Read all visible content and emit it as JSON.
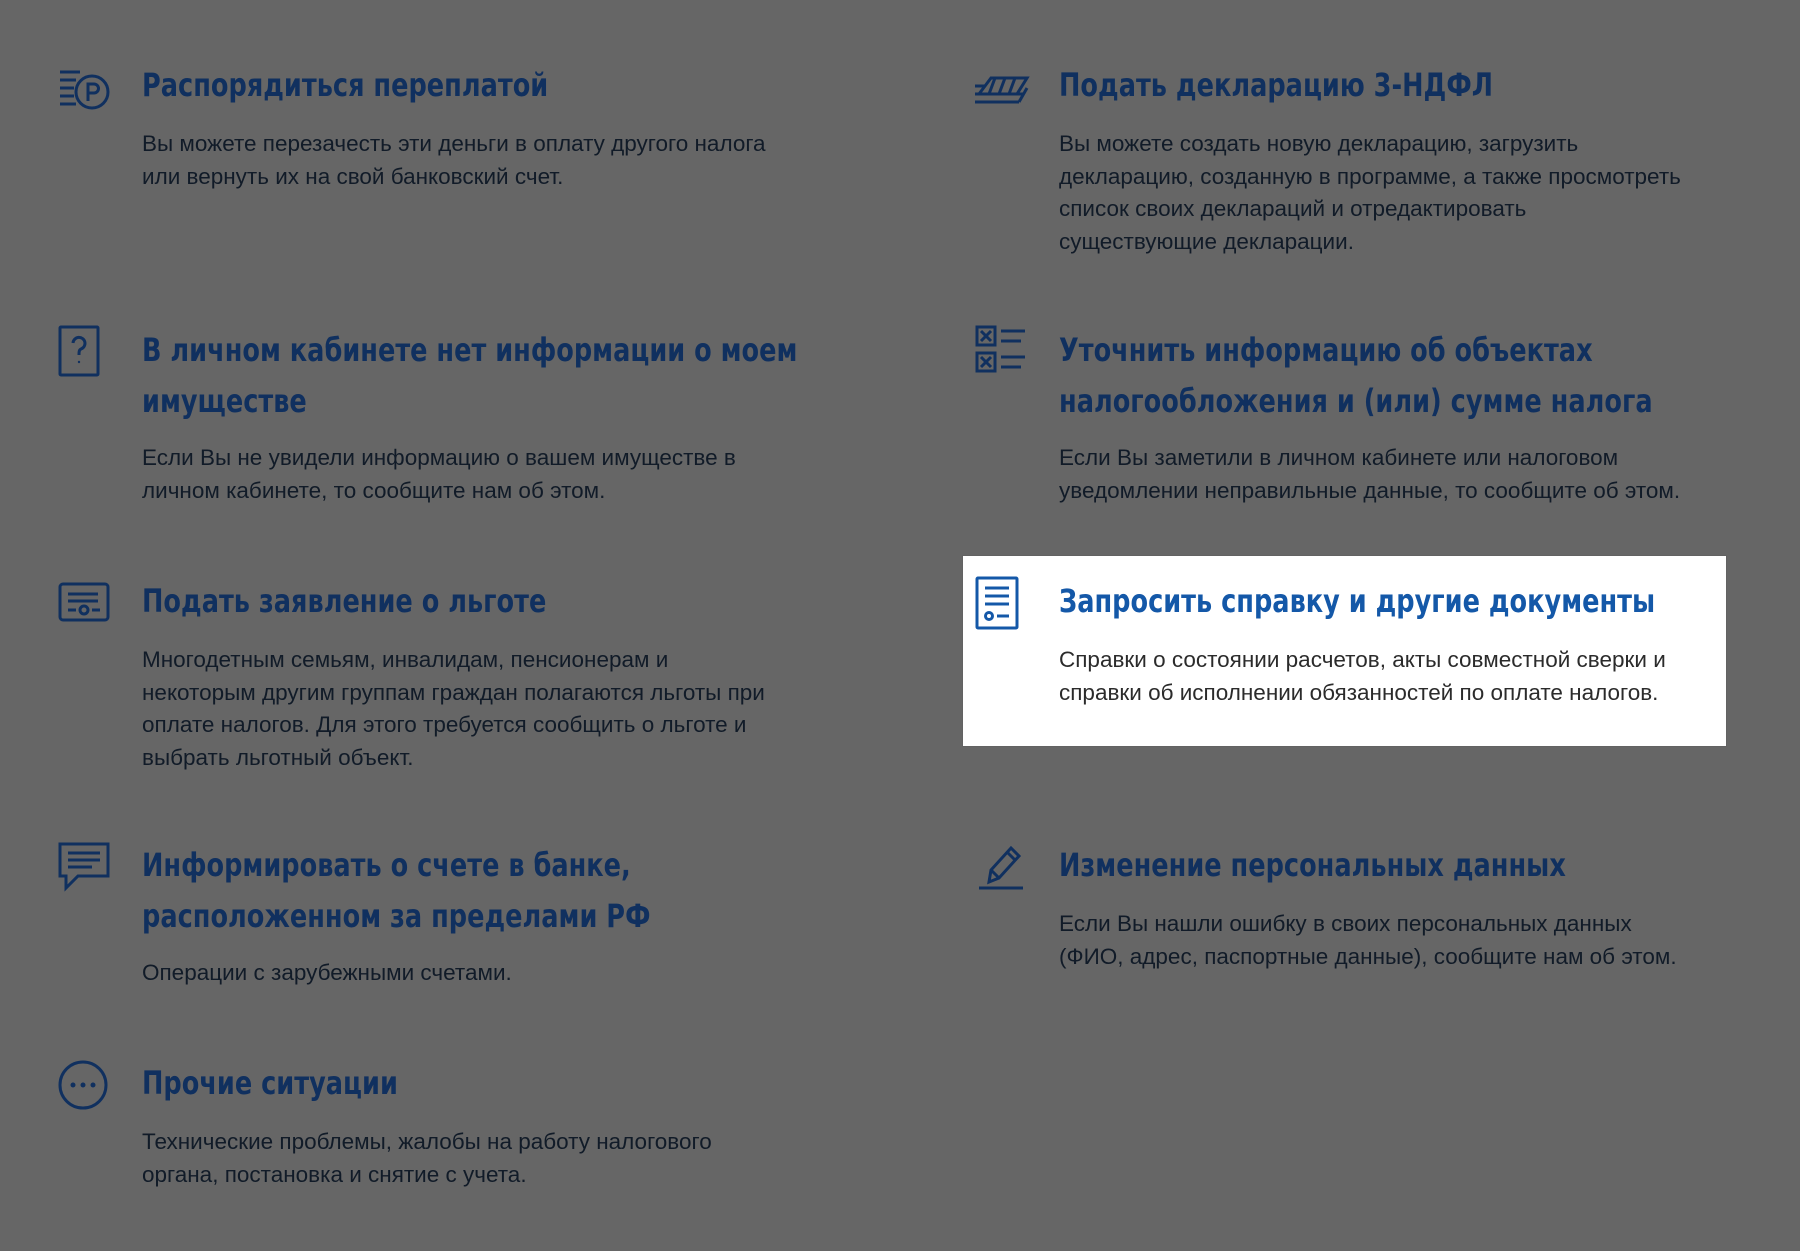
{
  "colors": {
    "overlay": "#666666",
    "title_dim": "#10305f",
    "title_active": "#1458a8",
    "text_dim": "#111b28",
    "card_bg": "#ffffff"
  },
  "items": [
    {
      "icon": "coins-ruble-icon",
      "title_lines": [
        "Распорядиться переплатой"
      ],
      "desc_lines": [
        "Вы можете перезачесть эти деньги в оплату другого налога",
        "или вернуть их на свой банковский счет."
      ]
    },
    {
      "icon": "document-stack-icon",
      "title_lines": [
        "Подать декларацию 3-НДФЛ"
      ],
      "desc_lines": [
        "Вы можете создать новую декларацию, загрузить",
        "декларацию, созданную в программе, а также просмотреть",
        "список своих деклараций и отредактировать",
        "существующие декларации."
      ]
    },
    {
      "icon": "question-document-icon",
      "title_lines": [
        "В личном кабинете нет информации о моем",
        "имуществе"
      ],
      "desc_lines": [
        "Если Вы не увидели информацию о вашем имуществе в",
        "личном кабинете, то сообщите нам об этом."
      ]
    },
    {
      "icon": "checklist-cross-icon",
      "title_lines": [
        "Уточнить информацию об объектах",
        "налогообложения и (или) сумме налога"
      ],
      "desc_lines": [
        "Если Вы заметили в личном кабинете или налоговом",
        "уведомлении неправильные данные, то сообщите об этом."
      ]
    },
    {
      "icon": "benefit-card-icon",
      "title_lines": [
        "Подать заявление о льготе"
      ],
      "desc_lines": [
        "Многодетным семьям, инвалидам, пенсионерам и",
        "некоторым другим группам граждан полагаются льготы при",
        "оплате налогов. Для этого требуется сообщить о льготе и",
        "выбрать льготный объект."
      ]
    },
    {
      "icon": "certificate-document-icon",
      "title_lines": [
        "Запросить справку и другие документы"
      ],
      "desc_lines": [
        "Справки о состоянии расчетов, акты совместной сверки и",
        "справки об исполнении обязанностей по оплате налогов."
      ]
    },
    {
      "icon": "chat-message-icon",
      "title_lines": [
        "Информировать о счете в банке,",
        "расположенном за пределами РФ"
      ],
      "desc_lines": [
        "Операции с зарубежными счетами."
      ]
    },
    {
      "icon": "pencil-edit-icon",
      "title_lines": [
        "Изменение персональных данных"
      ],
      "desc_lines": [
        "Если Вы нашли ошибку в своих персональных данных",
        "(ФИО, адрес, паспортные данные), сообщите нам об этом."
      ]
    },
    {
      "icon": "more-dots-icon",
      "title_lines": [
        "Прочие ситуации"
      ],
      "desc_lines": [
        "Технические проблемы, жалобы на работу налогового",
        "органа, постановка и снятие с учета."
      ]
    }
  ]
}
